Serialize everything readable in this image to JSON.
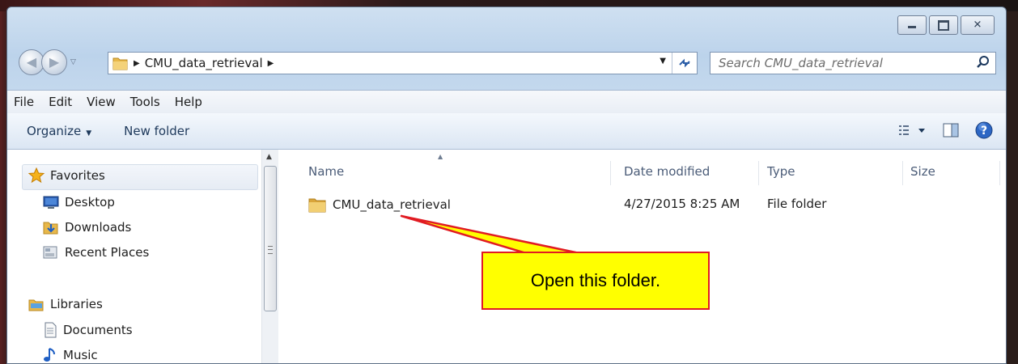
{
  "window": {
    "minimize_glyph": "",
    "maximize_glyph": "",
    "close_glyph": "✕"
  },
  "address": {
    "path": "CMU_data_retrieval",
    "search_placeholder": "Search CMU_data_retrieval"
  },
  "menu": {
    "items": [
      "File",
      "Edit",
      "View",
      "Tools",
      "Help"
    ]
  },
  "commands": {
    "organize": "Organize",
    "new_folder": "New folder"
  },
  "navpane": {
    "favorites": "Favorites",
    "desktop": "Desktop",
    "downloads": "Downloads",
    "recent": "Recent Places",
    "libraries": "Libraries",
    "documents": "Documents",
    "music": "Music"
  },
  "columns": {
    "name": "Name",
    "date": "Date modified",
    "type": "Type",
    "size": "Size"
  },
  "file": {
    "name": "CMU_data_retrieval",
    "date": "4/27/2015 8:25 AM",
    "type": "File folder"
  },
  "callout": {
    "text": "Open this folder."
  },
  "colors": {
    "callout_fill": "#ffff00",
    "callout_border": "#e11b22",
    "folder": "#e8b84a"
  },
  "icons": [
    "back-arrow-icon",
    "forward-arrow-icon",
    "folder-icon",
    "refresh-icon",
    "search-icon",
    "star-icon",
    "desktop-icon",
    "downloads-icon",
    "recent-places-icon",
    "libraries-icon",
    "documents-icon",
    "music-icon",
    "view-options-icon",
    "preview-pane-icon",
    "help-icon"
  ]
}
